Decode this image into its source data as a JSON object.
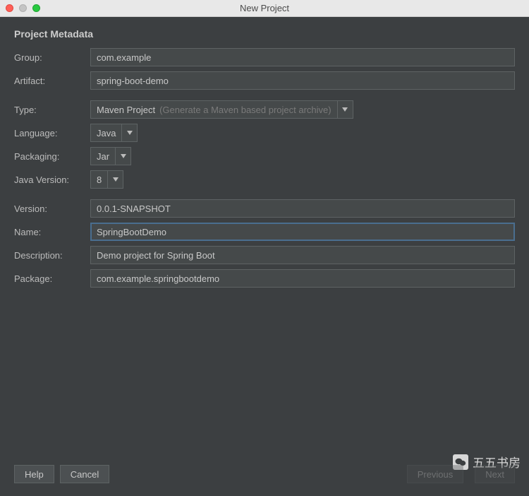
{
  "window": {
    "title": "New Project"
  },
  "section": {
    "title": "Project Metadata"
  },
  "labels": {
    "group": "Group:",
    "artifact": "Artifact:",
    "type": "Type:",
    "language": "Language:",
    "packaging": "Packaging:",
    "java_version": "Java Version:",
    "version": "Version:",
    "name": "Name:",
    "description": "Description:",
    "package": "Package:"
  },
  "values": {
    "group": "com.example",
    "artifact": "spring-boot-demo",
    "type": "Maven Project",
    "type_hint": "(Generate a Maven based project archive)",
    "language": "Java",
    "packaging": "Jar",
    "java_version": "8",
    "version": "0.0.1-SNAPSHOT",
    "name": "SpringBootDemo",
    "description": "Demo project for Spring Boot",
    "package": "com.example.springbootdemo"
  },
  "buttons": {
    "help": "Help",
    "cancel": "Cancel",
    "previous": "Previous",
    "next": "Next"
  },
  "watermark": "五五书房"
}
